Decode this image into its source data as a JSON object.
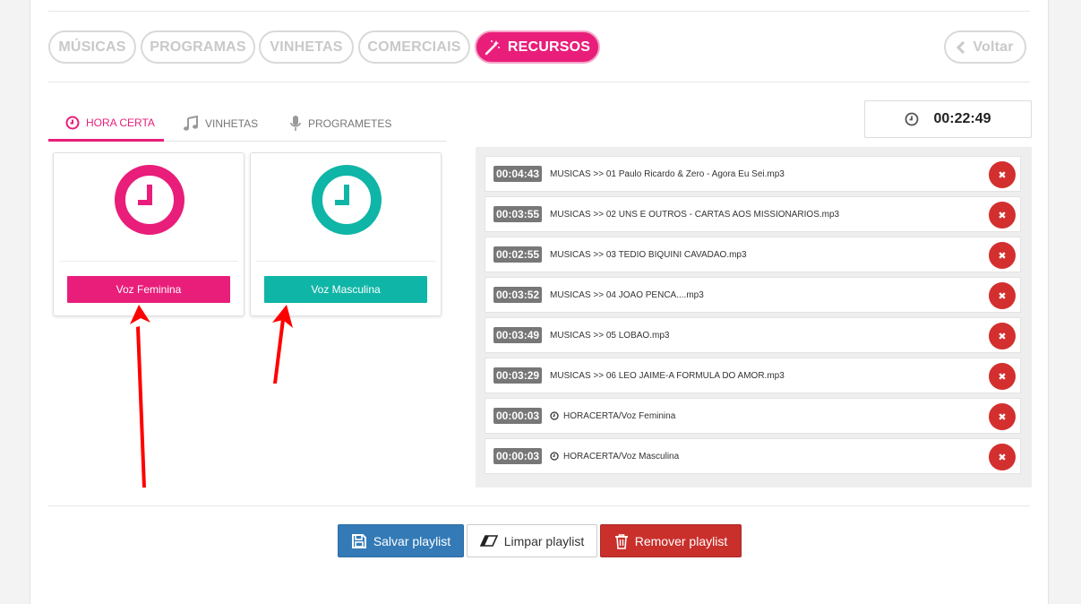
{
  "categories": [
    {
      "label": "MÚSICAS",
      "active": false
    },
    {
      "label": "PROGRAMAS",
      "active": false
    },
    {
      "label": "VINHETAS",
      "active": false
    },
    {
      "label": "COMERCIAIS",
      "active": false
    },
    {
      "label": "RECURSOS",
      "active": true
    }
  ],
  "back_label": "Voltar",
  "tabs": [
    {
      "label": "HORA CERTA",
      "icon": "clock-icon",
      "active": true
    },
    {
      "label": "VINHETAS",
      "icon": "music-note-icon",
      "active": false
    },
    {
      "label": "PROGRAMETES",
      "icon": "microphone-icon",
      "active": false
    }
  ],
  "voices": [
    {
      "label": "Voz Feminina",
      "color": "#e91e7a"
    },
    {
      "label": "Voz Masculina",
      "color": "#0fb5a6"
    }
  ],
  "timer": {
    "value": "00:22:49",
    "icon": "clock-icon"
  },
  "playlist": [
    {
      "duration": "00:04:43",
      "name": "MUSICAS >> 01 Paulo Ricardo & Zero - Agora Eu Sei.mp3",
      "type": "music"
    },
    {
      "duration": "00:03:55",
      "name": "MUSICAS >> 02 UNS E OUTROS - CARTAS AOS MISSIONARIOS.mp3",
      "type": "music"
    },
    {
      "duration": "00:02:55",
      "name": "MUSICAS >> 03 TEDIO BIQUINI CAVADAO.mp3",
      "type": "music"
    },
    {
      "duration": "00:03:52",
      "name": "MUSICAS >> 04 JOAO PENCA....mp3",
      "type": "music"
    },
    {
      "duration": "00:03:49",
      "name": "MUSICAS >> 05 LOBAO.mp3",
      "type": "music"
    },
    {
      "duration": "00:03:29",
      "name": "MUSICAS >> 06 LEO JAIME-A FORMULA DO AMOR.mp3",
      "type": "music"
    },
    {
      "duration": "00:00:03",
      "name": "HORACERTA/Voz Feminina",
      "type": "clock"
    },
    {
      "duration": "00:00:03",
      "name": "HORACERTA/Voz Masculina",
      "type": "clock"
    }
  ],
  "delete_glyph": "✖",
  "actions": {
    "save": "Salvar playlist",
    "clear": "Limpar playlist",
    "remove": "Remover playlist"
  },
  "colors": {
    "accent_pink": "#e91e7a",
    "accent_teal": "#0fb5a6",
    "save_blue": "#337ab7",
    "remove_red": "#c9302c",
    "delete_red": "#d32f2f",
    "annotation_arrow": "#ff0000"
  }
}
